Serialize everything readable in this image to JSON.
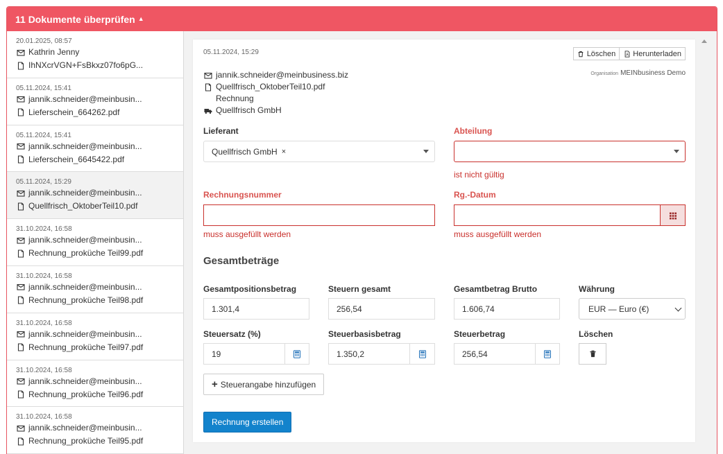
{
  "panel": {
    "title": "11 Dokumente überprüfen",
    "accent_color": "#ef5663"
  },
  "documents": [
    {
      "date": "20.01.2025, 08:57",
      "sender": "Kathrin Jenny",
      "file": "IhNXcrVGN+FsBkxz07fo6pG...",
      "active": false
    },
    {
      "date": "05.11.2024, 15:41",
      "sender": "jannik.schneider@meinbusin...",
      "file": "Lieferschein_664262.pdf",
      "active": false
    },
    {
      "date": "05.11.2024, 15:41",
      "sender": "jannik.schneider@meinbusin...",
      "file": "Lieferschein_6645422.pdf",
      "active": false
    },
    {
      "date": "05.11.2024, 15:29",
      "sender": "jannik.schneider@meinbusin...",
      "file": "Quellfrisch_OktoberTeil10.pdf",
      "active": true
    },
    {
      "date": "31.10.2024, 16:58",
      "sender": "jannik.schneider@meinbusin...",
      "file": "Rechnung_proküche Teil99.pdf",
      "active": false
    },
    {
      "date": "31.10.2024, 16:58",
      "sender": "jannik.schneider@meinbusin...",
      "file": "Rechnung_proküche Teil98.pdf",
      "active": false
    },
    {
      "date": "31.10.2024, 16:58",
      "sender": "jannik.schneider@meinbusin...",
      "file": "Rechnung_proküche Teil97.pdf",
      "active": false
    },
    {
      "date": "31.10.2024, 16:58",
      "sender": "jannik.schneider@meinbusin...",
      "file": "Rechnung_proküche Teil96.pdf",
      "active": false
    },
    {
      "date": "31.10.2024, 16:58",
      "sender": "jannik.schneider@meinbusin...",
      "file": "Rechnung_proküche Teil95.pdf",
      "active": false
    }
  ],
  "detail": {
    "date": "05.11.2024, 15:29",
    "delete_label": "Löschen",
    "download_label": "Herunterladen",
    "org_label": "Organisation",
    "org_name": "MEINbusiness Demo",
    "email": "jannik.schneider@meinbusiness.biz",
    "file": "Quellfrisch_OktoberTeil10.pdf",
    "doc_type": "Rechnung",
    "supplier_name": "Quellfrisch GmbH"
  },
  "form": {
    "supplier_label": "Lieferant",
    "supplier_value": "Quellfrisch GmbH",
    "supplier_clear": "×",
    "department_label": "Abteilung",
    "department_value": "",
    "department_error": "ist nicht gültig",
    "invoice_number_label": "Rechnungsnummer",
    "invoice_number_value": "",
    "invoice_number_error": "muss ausgefüllt werden",
    "invoice_date_label": "Rg.-Datum",
    "invoice_date_value": "",
    "invoice_date_error": "muss ausgefüllt werden",
    "error_color": "#c9302c"
  },
  "totals": {
    "title": "Gesamtbeträge",
    "position_total_label": "Gesamtpositionsbetrag",
    "position_total_value": "1.301,4",
    "tax_total_label": "Steuern gesamt",
    "tax_total_value": "256,54",
    "gross_total_label": "Gesamtbetrag Brutto",
    "gross_total_value": "1.606,74",
    "currency_label": "Währung",
    "currency_value": "EUR — Euro (€)",
    "tax_rate_label": "Steuersatz (%)",
    "tax_rate_value": "19",
    "tax_base_label": "Steuerbasisbetrag",
    "tax_base_value": "1.350,2",
    "tax_amount_label": "Steuerbetrag",
    "tax_amount_value": "256,54",
    "delete_label": "Löschen",
    "add_tax_label": "Steuerangabe hinzufügen",
    "create_invoice_label": "Rechnung erstellen",
    "primary_color": "#1383cc"
  }
}
